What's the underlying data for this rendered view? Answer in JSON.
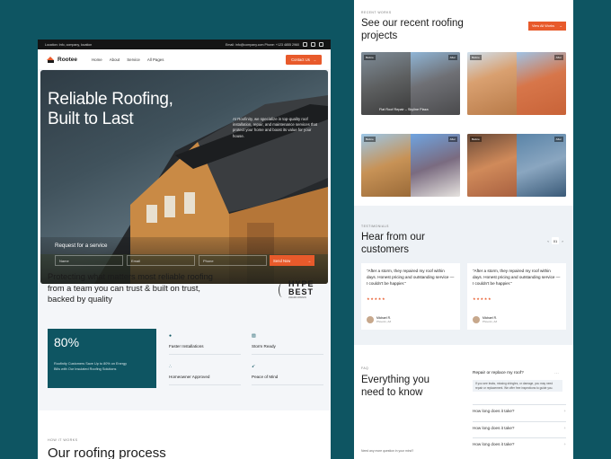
{
  "topbar": {
    "location": "Location: Info, company, location",
    "contact": "Email: info@company.com  Phone: +123 4855 2960"
  },
  "nav": {
    "brand": "Rootee",
    "links": [
      "Home",
      "About",
      "Service",
      "All Pages"
    ],
    "cta": "Contact Us"
  },
  "hero": {
    "title_line1": "Reliable Roofing,",
    "title_line2": "Built to Last",
    "description": "At Roofinity, we specialize in top-quality roof installation, repair, and maintenance services that protect your home and boost its value for your house.",
    "request_title": "Request for a service",
    "placeholders": [
      "Name",
      "Email",
      "Phone"
    ],
    "send": "Send Now"
  },
  "protect": {
    "text": "Protecting what matters most reliable roofing from a team you can trust & built on trust, backed by quality",
    "award_big1": "HYPE",
    "award_big2": "BEST",
    "award_small": "AWARD WINNIN"
  },
  "stat": {
    "number": "80%",
    "desc": "Roofinity Customers Save Up to 80% on Energy Bills with Our Insulated Roofing Solutions"
  },
  "features": [
    "Faster Installations",
    "Storm Ready",
    "Homeowner Approved",
    "Peace of Mind"
  ],
  "how": {
    "label": "HOW IT WORKS",
    "title": "Our roofing process"
  },
  "projects": {
    "label": "RECENT WORKS",
    "title": "See our recent roofing projects",
    "view_all": "View All Works",
    "cards": [
      {
        "before": "Before",
        "after": "After",
        "caption": "Flat Roof Repair – Skyline Plaza"
      },
      {
        "before": "Before",
        "after": "After",
        "caption": ""
      },
      {
        "before": "Before",
        "after": "After",
        "caption": ""
      },
      {
        "before": "Before",
        "after": "After",
        "caption": ""
      }
    ]
  },
  "testimonials": {
    "label": "TESTIMONIALS",
    "title": "Hear from our customers",
    "page": "01",
    "items": [
      {
        "quote": "“After a storm, they repaired my roof within days. Honest pricing and outstanding service — I couldn't be happier.”",
        "stars": "★★★★★",
        "name": "Michael R.",
        "location": "Phoenix, AZ"
      },
      {
        "quote": "“After a storm, they repaired my roof within days. Honest pricing and outstanding service — I couldn't be happier.”",
        "stars": "★★★★★",
        "name": "Michael R.",
        "location": "Phoenix, AZ"
      }
    ]
  },
  "faq": {
    "label": "FAQ",
    "title": "Everything you need to know",
    "open_question": "Repair or replace my roof?",
    "open_answer": "If you see leaks, missing shingles, or damage, you may need repair or replacement. We offer free inspections to guide you.",
    "questions": [
      "How long does it take?",
      "How long does it take?",
      "How long does it take?"
    ],
    "footer": "Need any more question in your mind?"
  }
}
